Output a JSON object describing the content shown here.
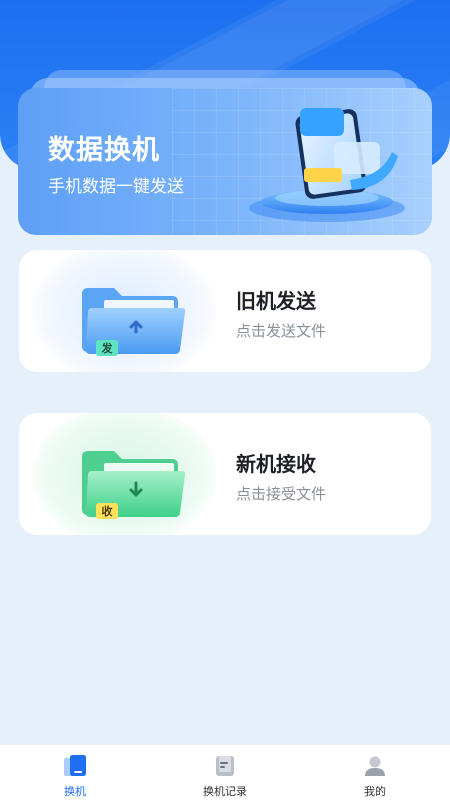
{
  "hero": {
    "title": "数据换机",
    "subtitle": "手机数据一键发送"
  },
  "cards": [
    {
      "title": "旧机发送",
      "subtitle": "点击发送文件",
      "badge": "发",
      "accent": "#4a9bf3"
    },
    {
      "title": "新机接收",
      "subtitle": "点击接受文件",
      "badge": "收",
      "accent": "#3ed089"
    }
  ],
  "tabbar": {
    "items": [
      {
        "label": "换机",
        "icon": "phone-transfer-icon",
        "active": true
      },
      {
        "label": "换机记录",
        "icon": "record-icon",
        "active": false
      },
      {
        "label": "我的",
        "icon": "user-icon",
        "active": false
      }
    ]
  },
  "colors": {
    "primary": "#1e6ef2",
    "background": "#e6f0fb",
    "send_badge": "#5fe3c1",
    "recv_badge": "#ffe05a"
  }
}
